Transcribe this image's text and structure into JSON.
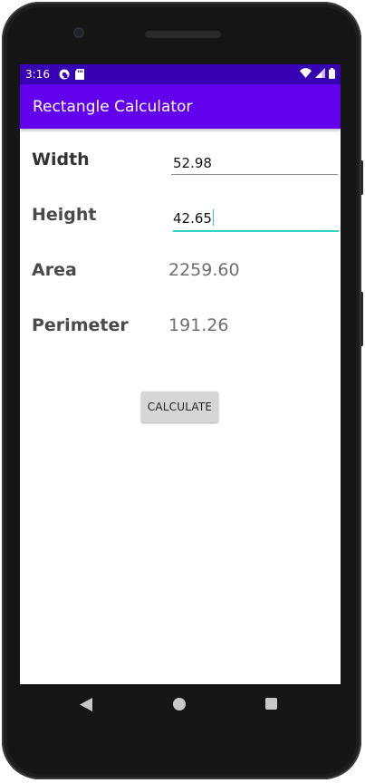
{
  "status_bar": {
    "time": "3:16",
    "icons_left": [
      "pocket-casts-icon",
      "sd-card-icon"
    ],
    "icons_right": [
      "wifi-icon",
      "cell-signal-icon",
      "battery-icon"
    ]
  },
  "app_bar": {
    "title": "Rectangle Calculator"
  },
  "form": {
    "width": {
      "label": "Width",
      "value": "52.98"
    },
    "height": {
      "label": "Height",
      "value": "42.65"
    },
    "area": {
      "label": "Area",
      "value": "2259.60"
    },
    "perimeter": {
      "label": "Perimeter",
      "value": "191.26"
    }
  },
  "actions": {
    "calculate_label": "CALCULATE"
  },
  "colors": {
    "status_bar": "#3700b3",
    "app_bar": "#6200ee",
    "focus_accent": "#2ed3c2"
  },
  "navigation": {
    "buttons": [
      "back-icon",
      "home-icon",
      "recents-icon"
    ]
  }
}
